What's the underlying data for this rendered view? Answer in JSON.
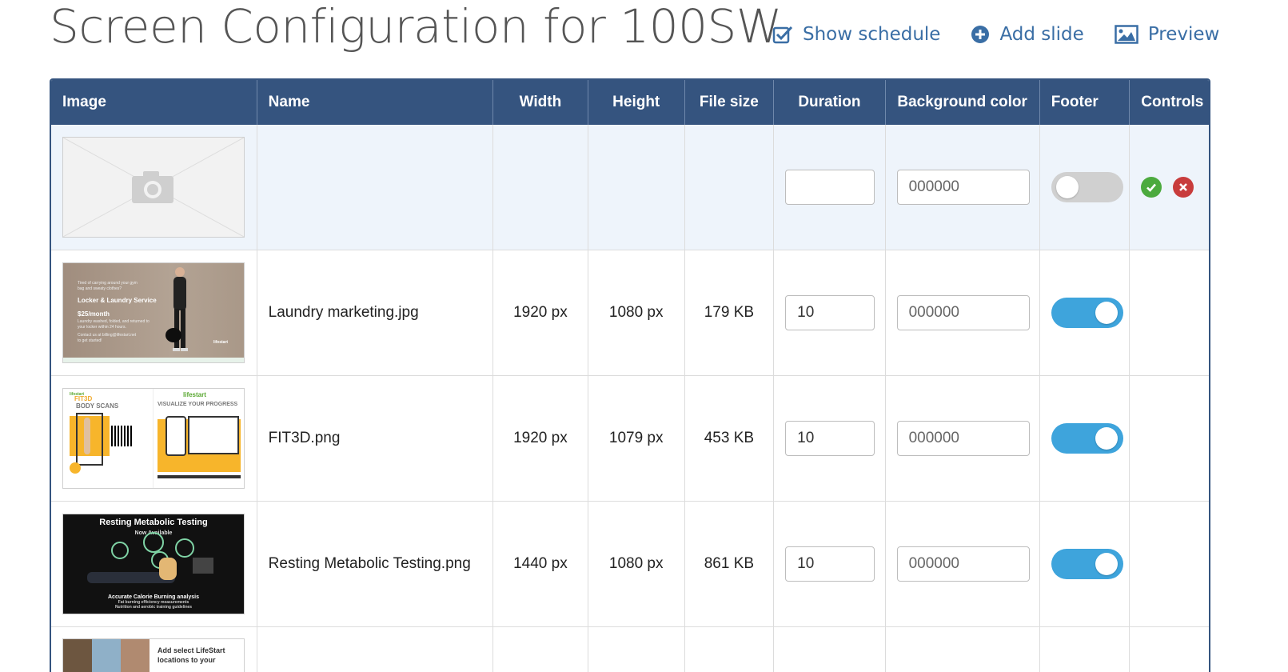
{
  "page": {
    "title": "Screen Configuration for 100SW"
  },
  "toolbar": {
    "show_schedule": "Show schedule",
    "add_slide": "Add slide",
    "preview": "Preview"
  },
  "table": {
    "headers": {
      "image": "Image",
      "name": "Name",
      "width": "Width",
      "height": "Height",
      "file_size": "File size",
      "duration": "Duration",
      "background_color": "Background color",
      "footer": "Footer",
      "controls": "Controls"
    },
    "new_row": {
      "duration": "",
      "background_color_placeholder": "000000",
      "footer_on": false
    },
    "rows": [
      {
        "name": "Laundry marketing.jpg",
        "width": "1920 px",
        "height": "1080 px",
        "file_size": "179 KB",
        "duration": "10",
        "background_color_placeholder": "000000",
        "footer_on": true,
        "thumb": {
          "lines": [
            "Tired of carrying around your gym",
            "bag and sweaty clothes?",
            "Locker & Laundry Service",
            "$25/month",
            "Laundry washed, folded, and returned to",
            "your locker within 24 hours.",
            "Contact us at billing@lifestart.net",
            "to get started!",
            "lifestart"
          ]
        }
      },
      {
        "name": "FIT3D.png",
        "width": "1920 px",
        "height": "1079 px",
        "file_size": "453 KB",
        "duration": "10",
        "background_color_placeholder": "000000",
        "footer_on": true,
        "thumb": {
          "lines": [
            "lifestart",
            "FIT3D",
            "BODY SCANS",
            "lifestart",
            "VISUALIZE YOUR PROGRESS"
          ]
        }
      },
      {
        "name": "Resting Metabolic Testing.png",
        "width": "1440 px",
        "height": "1080 px",
        "file_size": "861 KB",
        "duration": "10",
        "background_color_placeholder": "000000",
        "footer_on": true,
        "thumb": {
          "lines": [
            "Resting Metabolic Testing",
            "Now Available",
            "Accurate Calorie Burning analysis",
            "Fat burning efficiency measurements",
            "Nutrition and aerobic training guidelines"
          ]
        }
      },
      {
        "thumb": {
          "lines": [
            "Add select LifeStart",
            "locations to your"
          ]
        }
      }
    ]
  },
  "colors": {
    "header_bg": "#35547f",
    "accent_link": "#3a6ea5",
    "toggle_on": "#3ea4dc",
    "toggle_off": "#d0d0d0",
    "confirm": "#4caa3e",
    "cancel": "#c83c3c"
  }
}
